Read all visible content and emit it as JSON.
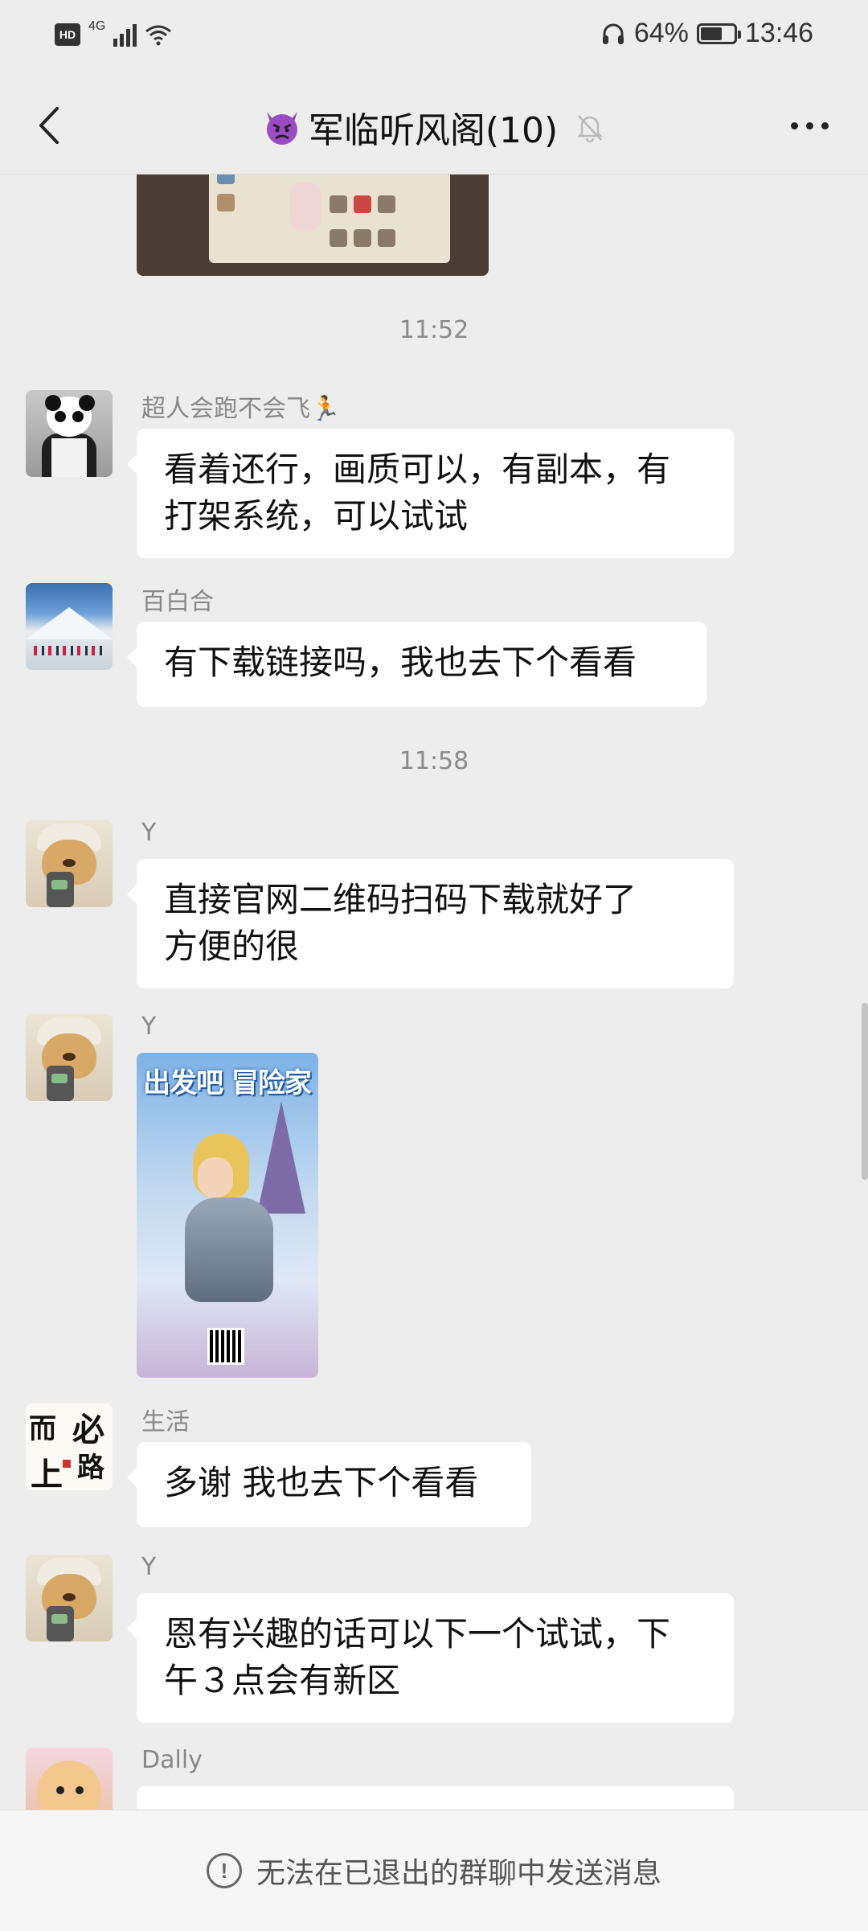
{
  "status_bar": {
    "hd": "HD",
    "network": "4G",
    "battery_text": "64%",
    "battery_level": 0.64,
    "time": "13:46"
  },
  "header": {
    "title": "军临听风阁(10)",
    "icons": [
      "back-arrow-icon",
      "devil-emoji-icon",
      "mute-bell-icon",
      "more-dots-icon"
    ]
  },
  "timestamps": {
    "first": "11:52",
    "second": "11:58"
  },
  "messages": [
    {
      "sender": "超人会跑不会飞🏃",
      "text_lines": [
        "看着还行，画质可以，有副本，有",
        "打架系统，可以试试"
      ]
    },
    {
      "sender": "百白合",
      "text_lines": [
        "有下载链接吗，我也去下个看看"
      ]
    },
    {
      "sender": "Y",
      "text_lines": [
        "直接官网二维码扫码下载就好了",
        "方便的很"
      ]
    },
    {
      "sender": "Y",
      "poster_title": "出发吧 冒险家"
    },
    {
      "sender": "生活",
      "text_lines": [
        "多谢 我也去下个看看"
      ]
    },
    {
      "sender": "Y",
      "text_lines": [
        "恩有兴趣的话可以下一个试试，下",
        "午３点会有新区"
      ]
    },
    {
      "sender": "Dally"
    }
  ],
  "avatar_art": {
    "callig_chars": [
      "而",
      "上",
      "必",
      "路"
    ]
  },
  "footer": {
    "notice": "无法在已退出的群聊中发送消息",
    "icon": "exclamation-circle-icon"
  },
  "colors": {
    "background": "#ededed",
    "bubble": "#ffffff",
    "sender": "#888888"
  }
}
